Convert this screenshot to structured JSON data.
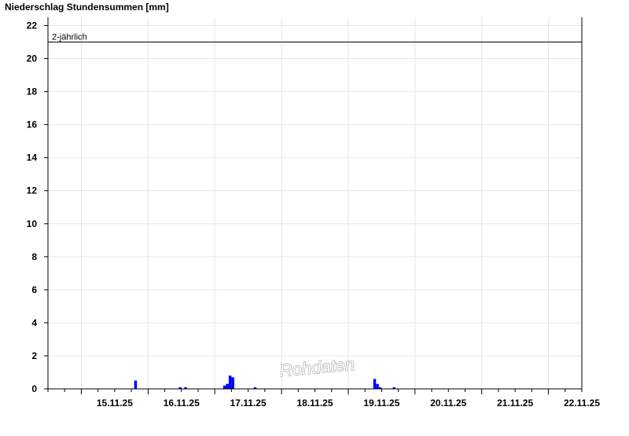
{
  "chart_data": {
    "type": "bar",
    "title": "Niederschlag Stundensummen [mm]",
    "xlabel": "",
    "ylabel": "",
    "ylim": [
      0,
      22.5
    ],
    "yticks": [
      0,
      2,
      4,
      6,
      8,
      10,
      12,
      14,
      16,
      18,
      20,
      22
    ],
    "grid": true,
    "legend": "none",
    "x_axis": {
      "type": "date",
      "range": [
        "14.11.25 12:00",
        "22.11.25 12:00"
      ],
      "tick_labels": [
        {
          "date": "15.11.25",
          "label": "15.11.25"
        },
        {
          "date": "16.11.25",
          "label": "16.11.25"
        },
        {
          "date": "17.11.25",
          "label": "17.11.25"
        },
        {
          "date": "18.11.25",
          "label": "18.11.25"
        },
        {
          "date": "19.11.25",
          "label": "19.11.25"
        },
        {
          "date": "20.11.25",
          "label": "20.11.25"
        },
        {
          "date": "21.11.25",
          "label": "21.11.25"
        },
        {
          "date": "22.11.25",
          "label": "22.11.25"
        }
      ]
    },
    "series": [
      {
        "color": "#0000ff",
        "points": [
          {
            "x": "15.11.25 20:00",
            "y": 0.5
          },
          {
            "x": "16.11.25 12:00",
            "y": 0.1
          },
          {
            "x": "16.11.25 14:00",
            "y": 0.1
          },
          {
            "x": "17.11.25 04:00",
            "y": 0.2
          },
          {
            "x": "17.11.25 05:00",
            "y": 0.3
          },
          {
            "x": "17.11.25 06:00",
            "y": 0.8
          },
          {
            "x": "17.11.25 07:00",
            "y": 0.7
          },
          {
            "x": "17.11.25 15:00",
            "y": 0.1
          },
          {
            "x": "19.11.25 10:00",
            "y": 0.6
          },
          {
            "x": "19.11.25 11:00",
            "y": 0.3
          },
          {
            "x": "19.11.25 12:00",
            "y": 0.1
          },
          {
            "x": "19.11.25 17:00",
            "y": 0.1
          }
        ]
      }
    ],
    "reference_line": {
      "y": 21,
      "label": "2-jährlich",
      "color": "#000000"
    },
    "watermark": "Rohdaten"
  }
}
